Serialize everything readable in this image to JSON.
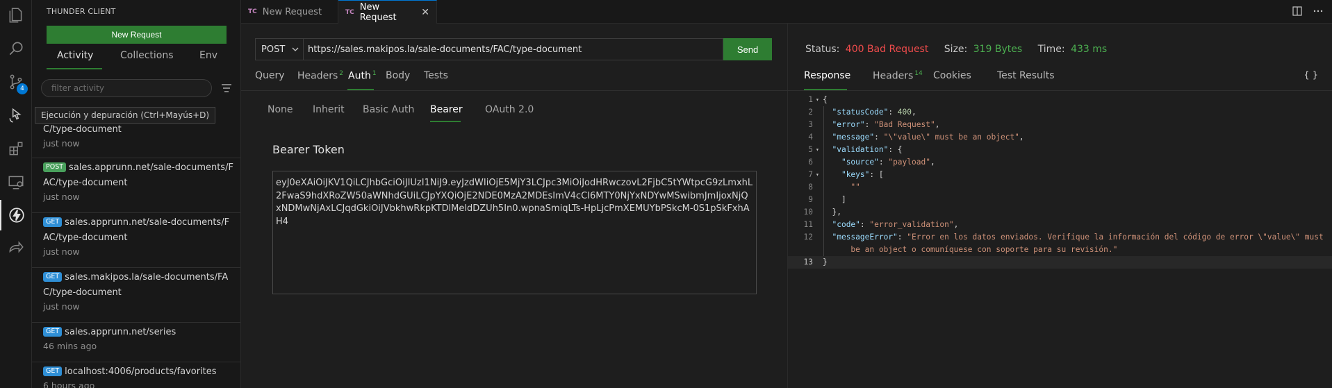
{
  "activity_bar": {
    "items": [
      {
        "name": "explorer-icon"
      },
      {
        "name": "search-icon"
      },
      {
        "name": "source-control-icon",
        "badge": "4"
      },
      {
        "name": "run-debug-icon"
      },
      {
        "name": "extensions-icon"
      },
      {
        "name": "remote-explorer-icon"
      },
      {
        "name": "thunder-client-icon"
      },
      {
        "name": "live-share-icon"
      }
    ]
  },
  "sidebar": {
    "title": "THUNDER CLIENT",
    "new_request": "New Request",
    "tabs": [
      "Activity",
      "Collections",
      "Env"
    ],
    "filter_placeholder": "filter activity",
    "items": [
      {
        "method": "",
        "url": "nts/FA\nC/type-document",
        "time": "just now"
      },
      {
        "method": "POST",
        "url": "sales.apprunn.net/sale-documents/FAC/type-document",
        "time": "just now"
      },
      {
        "method": "GET",
        "url": "sales.apprunn.net/sale-documents/FAC/type-document",
        "time": "just now"
      },
      {
        "method": "GET",
        "url": "sales.makipos.la/sale-documents/FAC/type-document",
        "time": "just now"
      },
      {
        "method": "GET",
        "url": "sales.apprunn.net/series",
        "time": "46 mins ago"
      },
      {
        "method": "GET",
        "url": "localhost:4006/products/favorites",
        "time": "6 hours ago"
      }
    ],
    "tooltip": "Ejecución y depuración (Ctrl+Mayús+D)"
  },
  "tabs": [
    {
      "icon": "TC",
      "label": "New Request"
    },
    {
      "icon": "TC",
      "label": "New Request",
      "close": "✕"
    }
  ],
  "request": {
    "method": "POST",
    "url": "https://sales.makipos.la/sale-documents/FAC/type-document",
    "send": "Send",
    "tabs": [
      {
        "label": "Query",
        "count": ""
      },
      {
        "label": "Headers",
        "count": "2"
      },
      {
        "label": "Auth",
        "count": "1"
      },
      {
        "label": "Body",
        "count": ""
      },
      {
        "label": "Tests",
        "count": ""
      }
    ],
    "auth_tabs": [
      "None",
      "Inherit",
      "Basic Auth",
      "Bearer",
      "OAuth 2.0"
    ],
    "bearer_label": "Bearer Token",
    "token": "eyJ0eXAiOiJKV1QiLCJhbGciOiJIUzI1NiJ9.eyJzdWIiOjE5MjY3LCJpc3MiOiJodHRwczovL2FjbC5tYWtpcG9zLmxhL2FwaS9hdXRoZW50aWNhdGUiLCJpYXQiOjE2NDE0MzA2MDEsImV4cCI6MTY0NjYxNDYwMSwibmJmIjoxNjQxNDMwNjAxLCJqdGkiOiJVbkhwRkpKTDlMeldDZUh5In0.wpnaSmiqLTs-HpLjcPmXEMUYbPSkcM-0S1pSkFxhAH4"
  },
  "response": {
    "status_label": "Status:",
    "status": "400 Bad Request",
    "size_label": "Size:",
    "size": "319 Bytes",
    "time_label": "Time:",
    "time": "433 ms",
    "tabs": [
      {
        "label": "Response",
        "count": ""
      },
      {
        "label": "Headers",
        "count": "14"
      },
      {
        "label": "Cookies",
        "count": ""
      },
      {
        "label": "Test Results",
        "count": ""
      }
    ],
    "braces": "{ }",
    "line_numbers": [
      "1",
      "2",
      "3",
      "4",
      "5",
      "6",
      "7",
      "8",
      "9",
      "10",
      "11",
      "12",
      "",
      "13"
    ],
    "lines": {
      "l1": "{",
      "l2_key": "\"statusCode\"",
      "l2_val": "400",
      "l3_key": "\"error\"",
      "l3_val": "\"Bad Request\"",
      "l4_key": "\"message\"",
      "l4_val": "\"\\\"value\\\" must be an object\"",
      "l5_key": "\"validation\"",
      "l5_rest": ": {",
      "l6_key": "\"source\"",
      "l6_val": "\"payload\"",
      "l7_key": "\"keys\"",
      "l7_rest": ": [",
      "l8_val": "\"\"",
      "l9": "]",
      "l10": "},",
      "l11_key": "\"code\"",
      "l11_val": "\"error_validation\"",
      "l12_key": "\"messageError\"",
      "l12_val": "\"Error en los datos enviados. Verifique la información del código de error \\\"value\\\" must",
      "l12_cont": "be an object o comuníquese con soporte para su revisión.\"",
      "l13": "}"
    }
  },
  "colors": {
    "accent_green": "#2e7d32",
    "status_red": "#f14c4c",
    "value_green": "#4caf50",
    "badge_blue": "#0078d4"
  }
}
